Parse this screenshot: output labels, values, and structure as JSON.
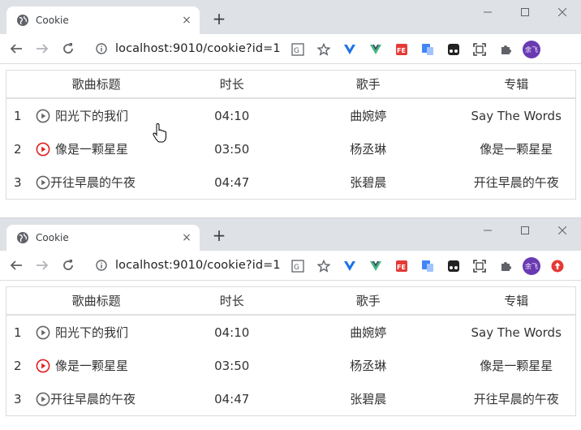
{
  "browser": {
    "tab_title": "Cookie",
    "close_glyph": "×",
    "newtab_glyph": "+",
    "url": "localhost:9010/cookie?id=1",
    "profile_avatar": "余飞"
  },
  "table": {
    "headers": [
      "歌曲标题",
      "时长",
      "歌手",
      "专辑"
    ],
    "rows": [
      {
        "index": "1",
        "title": "阳光下的我们",
        "duration": "04:10",
        "singer": "曲婉婷",
        "album": "Say The Words",
        "play_color": "#666666"
      },
      {
        "index": "2",
        "title": "像是一颗星星",
        "duration": "03:50",
        "singer": "杨丞琳",
        "album": "像是一颗星星",
        "play_color": "#e02020"
      },
      {
        "index": "3",
        "title": "开往早晨的午夜",
        "duration": "04:47",
        "singer": "张碧晨",
        "album": "开往早晨的午夜",
        "play_color": "#666666"
      }
    ]
  },
  "icons": {
    "favicon": "globe-icon",
    "back": "back-arrow-icon",
    "forward": "forward-arrow-icon",
    "reload": "reload-icon",
    "info": "info-icon",
    "translate": "translate-icon",
    "star": "bookmark-star-icon",
    "extensions": "puzzle-icon"
  },
  "colors": {
    "tabstrip_bg": "#dee1e6",
    "play_active": "#e02020",
    "play_default": "#666666"
  }
}
